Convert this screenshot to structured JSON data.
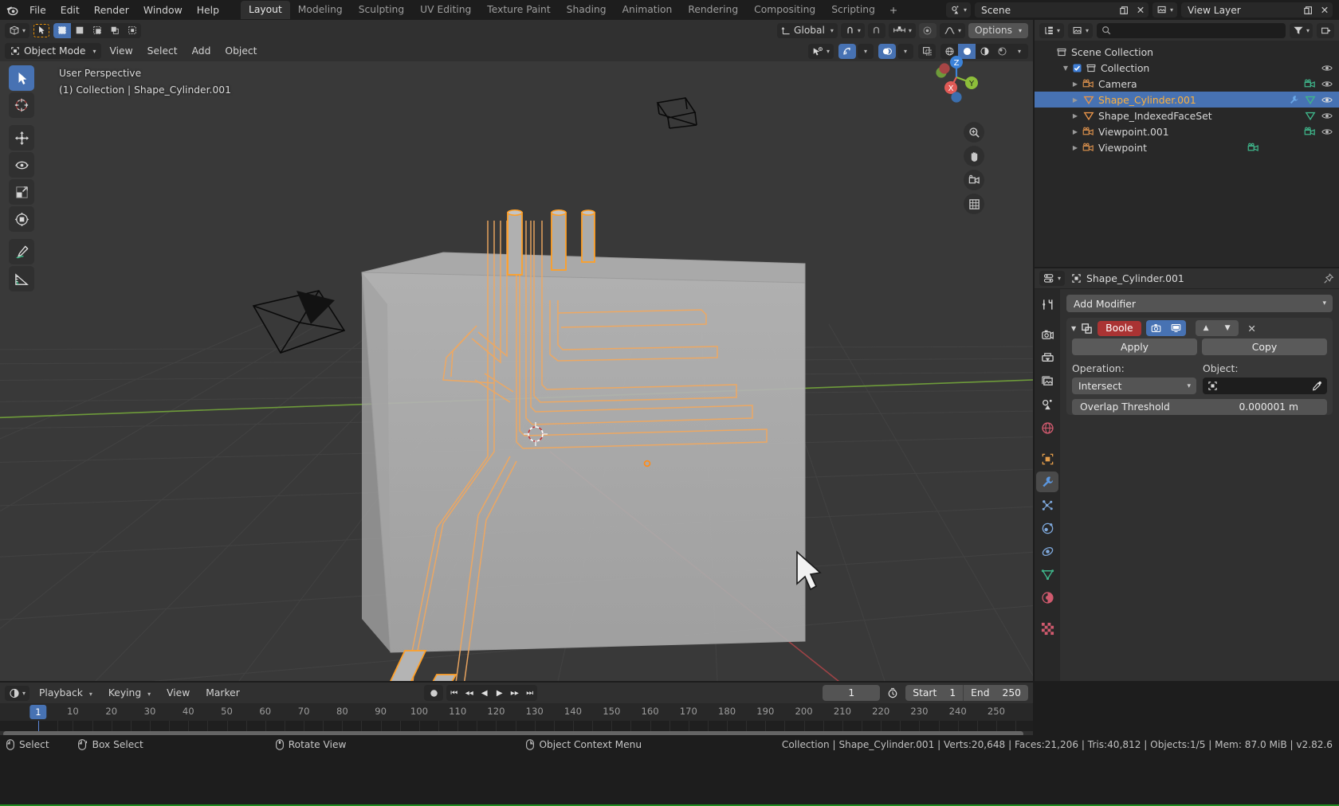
{
  "topbar": {
    "logo_icon": "blender-logo-icon",
    "menus": [
      "File",
      "Edit",
      "Render",
      "Window",
      "Help"
    ],
    "workspaces": [
      {
        "label": "Layout",
        "active": true
      },
      {
        "label": "Modeling",
        "active": false
      },
      {
        "label": "Sculpting",
        "active": false
      },
      {
        "label": "UV Editing",
        "active": false
      },
      {
        "label": "Texture Paint",
        "active": false
      },
      {
        "label": "Shading",
        "active": false
      },
      {
        "label": "Animation",
        "active": false
      },
      {
        "label": "Rendering",
        "active": false
      },
      {
        "label": "Compositing",
        "active": false
      },
      {
        "label": "Scripting",
        "active": false
      }
    ],
    "add_workspace_label": "+",
    "scene_name": "Scene",
    "view_layer_name": "View Layer",
    "scene_icon": "scene-icon",
    "copy_icon": "new-scene-icon",
    "close_icon": "close-icon",
    "viewlayer_icon": "view-layer-icon"
  },
  "viewport": {
    "header": {
      "editor_type_icon": "editor-type-3dview-icon",
      "mode": "Object Mode",
      "mode_icon": "object-mode-icon",
      "menus": [
        "View",
        "Select",
        "Add",
        "Object"
      ],
      "select_mode_icons": [
        "tweak-select-icon",
        "box-select-icon",
        "circle-select-icon",
        "lasso-select-icon"
      ],
      "transform_orientation": "Global",
      "orientation_icon": "orientation-icon",
      "snap_icon": "magnet-icon",
      "snap_target_icon": "snap-increment-icon",
      "proportional_icon": "proportional-edit-icon",
      "falloff_icon": "falloff-smooth-icon",
      "options_label": "Options",
      "visibility_icon": "visibility-eye-icon",
      "gizmo_icon": "gizmo-icon",
      "overlays_icon": "overlays-icon",
      "xray_icon": "xray-toggle-icon",
      "shading_icons": [
        "shading-wireframe-icon",
        "shading-solid-icon",
        "shading-material-icon",
        "shading-rendered-icon"
      ],
      "shading_active_index": 1
    },
    "overlay_text_line1": "User Perspective",
    "overlay_text_line2": "(1) Collection | Shape_Cylinder.001",
    "toolbar": [
      {
        "name": "tweak-tool",
        "active": true
      },
      {
        "name": "cursor-tool",
        "active": false
      },
      {
        "name": "move-tool",
        "active": false
      },
      {
        "name": "rotate-tool",
        "active": false
      },
      {
        "name": "scale-tool",
        "active": false
      },
      {
        "name": "transform-tool",
        "active": false
      },
      {
        "name": "annotate-tool",
        "active": false
      },
      {
        "name": "measure-tool",
        "active": false
      }
    ],
    "gizmo_axes": [
      "Z",
      "Y",
      "X"
    ],
    "nav_buttons": [
      "zoom-icon",
      "pan-hand-icon",
      "camera-view-icon",
      "toggle-ortho-icon"
    ]
  },
  "outliner": {
    "display_mode_icon": "outliner-display-mode-icon",
    "filter_scene_icon": "outliner-scene-filter-icon",
    "search_placeholder": "",
    "search_icon": "search-icon",
    "filter_icon": "filter-icon",
    "new_collection_icon": "new-collection-icon",
    "rows": [
      {
        "indent": 0,
        "label": "Scene Collection",
        "icon": "collection-icon",
        "selected": false,
        "disclosure": "",
        "checkbox": false,
        "eye": false,
        "badges": []
      },
      {
        "indent": 1,
        "label": "Collection",
        "icon": "collection-icon",
        "selected": false,
        "disclosure": "open",
        "checkbox": true,
        "eye": true,
        "badges": []
      },
      {
        "indent": 2,
        "label": "Camera",
        "icon": "camera-object-icon",
        "selected": false,
        "disclosure": "closed",
        "checkbox": false,
        "eye": true,
        "badges": [
          "camera-data-icon"
        ]
      },
      {
        "indent": 2,
        "label": "Shape_Cylinder.001",
        "icon": "mesh-object-icon",
        "selected": true,
        "disclosure": "closed",
        "checkbox": false,
        "eye": true,
        "badges": [
          "modifier-icon",
          "mesh-data-icon"
        ]
      },
      {
        "indent": 2,
        "label": "Shape_IndexedFaceSet",
        "icon": "mesh-object-icon",
        "selected": false,
        "disclosure": "closed",
        "checkbox": false,
        "eye": true,
        "badges": [
          "mesh-data-icon"
        ]
      },
      {
        "indent": 2,
        "label": "Viewpoint.001",
        "icon": "camera-object-icon",
        "selected": false,
        "disclosure": "closed",
        "checkbox": false,
        "eye": true,
        "badges": [
          "camera-data-icon"
        ]
      },
      {
        "indent": 2,
        "label": "Viewpoint",
        "icon": "camera-object-icon",
        "selected": false,
        "disclosure": "closed",
        "checkbox": false,
        "eye": true,
        "badges": [
          "camera-data-icon"
        ]
      }
    ]
  },
  "properties": {
    "editor_icon": "properties-editor-icon",
    "breadcrumb_icon": "object-icon",
    "breadcrumb": "Shape_Cylinder.001",
    "pin_icon": "pin-icon",
    "tabs": [
      {
        "name": "tool-tab",
        "active": false
      },
      {
        "name": "render-tab",
        "active": false
      },
      {
        "name": "output-tab",
        "active": false
      },
      {
        "name": "view-layer-tab",
        "active": false
      },
      {
        "name": "scene-tab",
        "active": false
      },
      {
        "name": "world-tab",
        "active": false
      },
      {
        "name": "object-tab",
        "active": false
      },
      {
        "name": "modifier-tab",
        "active": true
      },
      {
        "name": "particles-tab",
        "active": false
      },
      {
        "name": "physics-tab",
        "active": false
      },
      {
        "name": "constraints-tab",
        "active": false
      },
      {
        "name": "object-data-tab",
        "active": false
      },
      {
        "name": "material-tab",
        "active": false
      },
      {
        "name": "texture-tab",
        "active": false
      }
    ],
    "add_modifier_label": "Add Modifier",
    "modifier": {
      "expand_icon": "collapse-triangle-icon",
      "type_icon": "boolean-modifier-icon",
      "name": "Boole",
      "name_bg": "#aa3333",
      "render_toggle_icon": "render-visibility-icon",
      "viewport_toggle_icon": "viewport-visibility-icon",
      "move_up_icon": "move-up-icon",
      "move_down_icon": "move-down-icon",
      "delete_icon": "delete-x-icon",
      "apply_label": "Apply",
      "copy_label": "Copy",
      "operation_label": "Operation:",
      "operation_value": "Intersect",
      "object_label": "Object:",
      "object_value": "",
      "object_icon": "object-field-icon",
      "eyedropper_icon": "eyedropper-icon",
      "overlap_label": "Overlap Threshold",
      "overlap_value": "0.000001 m"
    }
  },
  "timeline": {
    "editor_icon": "timeline-editor-icon",
    "menus": [
      "Playback",
      "Keying",
      "View",
      "Marker"
    ],
    "record_icon": "record-icon",
    "transport_icons": [
      "jump-start-icon",
      "prev-keyframe-icon",
      "play-reverse-icon",
      "play-icon",
      "next-keyframe-icon",
      "jump-end-icon"
    ],
    "current_frame": "1",
    "auto_key_icon": "auto-keying-icon",
    "start_label": "Start",
    "start_value": "1",
    "end_label": "End",
    "end_value": "250",
    "ruler_ticks": [
      "1",
      "10",
      "20",
      "30",
      "40",
      "50",
      "60",
      "70",
      "80",
      "90",
      "100",
      "110",
      "120",
      "130",
      "140",
      "150",
      "160",
      "170",
      "180",
      "190",
      "200",
      "210",
      "220",
      "230",
      "240",
      "250"
    ],
    "current_frame_badge": "1"
  },
  "statusbar": {
    "items": [
      {
        "icon": "mouse-left-icon",
        "label": "Select"
      },
      {
        "icon": "mouse-left-drag-icon",
        "label": "Box Select"
      },
      {
        "icon": "mouse-middle-icon",
        "label": "Rotate View"
      },
      {
        "icon": "mouse-right-icon",
        "label": "Object Context Menu"
      }
    ],
    "scene_stats": "Collection | Shape_Cylinder.001 | Verts:20,648 | Faces:21,206 | Tris:40,812 | Objects:1/5 | Mem: 87.0 MiB | v2.82.6"
  },
  "colors": {
    "accent_blue": "#4772b3",
    "selection_orange": "#ffb13b",
    "modifier_red": "#aa3333",
    "axis_x": "#e05a56",
    "axis_y": "#8dbe3a",
    "axis_z": "#3b82d8"
  }
}
